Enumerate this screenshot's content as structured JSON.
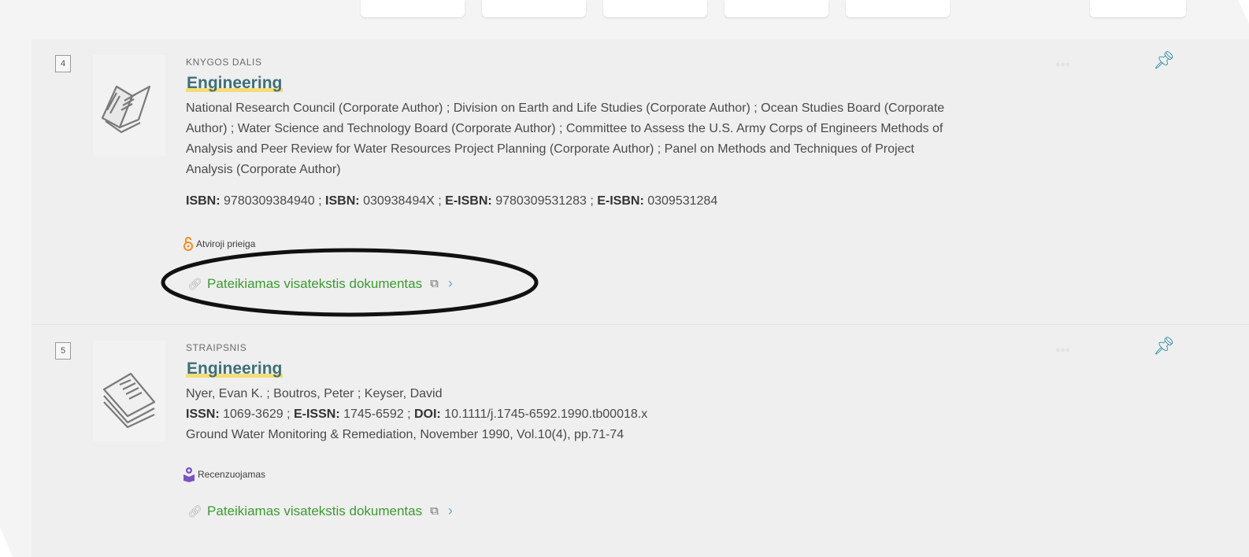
{
  "results": [
    {
      "number": "4",
      "type": "KNYGOS DALIS",
      "title": "Engineering",
      "authors_lines": [
        "National Research Council (Corporate Author) ; Division on Earth and Life Studies (Corporate Author) ; Ocean Studies Board (Corporate",
        "Author) ; Water Science and Technology Board (Corporate Author) ; Committee to Assess the U.S. Army Corps of Engineers Methods of",
        "Analysis and Peer Review for Water Resources Project Planning (Corporate Author) ; Panel on Methods and Techniques of Project",
        "Analysis (Corporate Author)"
      ],
      "identifiers": [
        {
          "label": "ISBN:",
          "value": "9780309384940"
        },
        {
          "label": "ISBN:",
          "value": "030938494X"
        },
        {
          "label": "E-ISBN:",
          "value": "9780309531283"
        },
        {
          "label": "E-ISBN:",
          "value": "0309531284"
        }
      ],
      "badge": "Atviroji prieiga",
      "badge_icon": "open-access-icon",
      "fulltext": "Pateikiamas visatekstis dokumentas"
    },
    {
      "number": "5",
      "type": "STRAIPSNIS",
      "title": "Engineering",
      "authors": "Nyer, Evan K. ; Boutros, Peter ; Keyser, David",
      "identifiers": [
        {
          "label": "ISSN:",
          "value": "1069-3629"
        },
        {
          "label": "E-ISSN:",
          "value": "1745-6592"
        },
        {
          "label": "DOI:",
          "value": "10.1111/j.1745-6592.1990.tb00018.x"
        }
      ],
      "source": "Ground Water Monitoring & Remediation, November 1990, Vol.10(4), pp.71-74",
      "badge": "Recenzuojamas",
      "badge_icon": "peer-reviewed-icon",
      "fulltext": "Pateikiamas visatekstis dokumentas"
    }
  ],
  "colors": {
    "title": "#3f6f78",
    "title_highlight": "#f3dd78",
    "link_green": "#3d9a32",
    "pin_teal": "#2d8fa3",
    "open_access_orange": "#f08a24",
    "peer_review_purple": "#7b52c4"
  },
  "icons": {
    "pin": "pin-icon",
    "link": "link-icon",
    "external": "external-link-icon",
    "chevron": "chevron-right-icon"
  }
}
